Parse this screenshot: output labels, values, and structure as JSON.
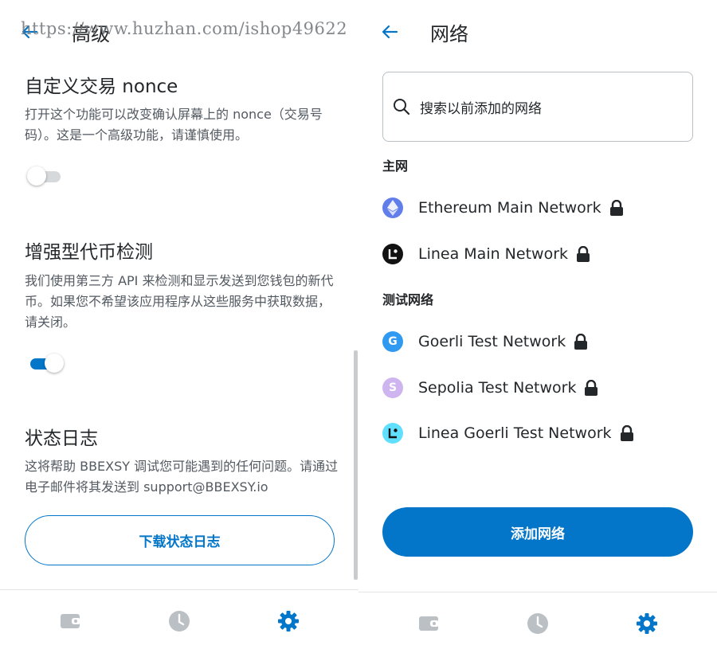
{
  "watermark": "https://www.huzhan.com/ishop49622",
  "left": {
    "title": "高级",
    "sections": [
      {
        "title": "自定义交易 nonce",
        "description": "打开这个功能可以改变确认屏幕上的 nonce（交易号码）。这是一个高级功能，请谨慎使用。",
        "toggle_on": false
      },
      {
        "title": "增强型代币检测",
        "description": "我们使用第三方 API 来检测和显示发送到您钱包的新代币。如果您不希望该应用程序从这些服务中获取数据，请关闭。",
        "toggle_on": true
      },
      {
        "title": "状态日志",
        "description": "这将帮助 BBEXSY 调试您可能遇到的任何问题。请通过电子邮件将其发送到 support@BBEXSY.io"
      }
    ],
    "download_button": "下载状态日志"
  },
  "right": {
    "title": "网络",
    "search_placeholder": "搜索以前添加的网络",
    "groups": [
      {
        "label": "主网",
        "networks": [
          {
            "name": "Ethereum Main Network",
            "avatar": "ethereum-logo-icon",
            "color": "#627eea",
            "initial": ""
          },
          {
            "name": "Linea Main Network",
            "avatar": "linea-logo-icon",
            "color": "#121212",
            "initial": ""
          }
        ]
      },
      {
        "label": "测试网络",
        "networks": [
          {
            "name": "Goerli Test Network",
            "avatar": "goerli-avatar-icon",
            "color": "#3099f2",
            "initial": "G"
          },
          {
            "name": "Sepolia Test Network",
            "avatar": "sepolia-avatar-icon",
            "color": "#cfb5f0",
            "initial": "S"
          },
          {
            "name": "Linea Goerli Test Network",
            "avatar": "linea-goerli-logo-icon",
            "color": "#61dfff",
            "initial": ""
          }
        ]
      }
    ],
    "add_button": "添加网络"
  },
  "tabs": [
    {
      "icon": "wallet-icon",
      "active": false
    },
    {
      "icon": "activity-clock-icon",
      "active": false
    },
    {
      "icon": "settings-gear-icon",
      "active": true
    }
  ],
  "colors": {
    "accent": "#0376c9",
    "text": "#24272a",
    "muted": "#535a61",
    "inactive_icon": "#bbc0c5"
  }
}
